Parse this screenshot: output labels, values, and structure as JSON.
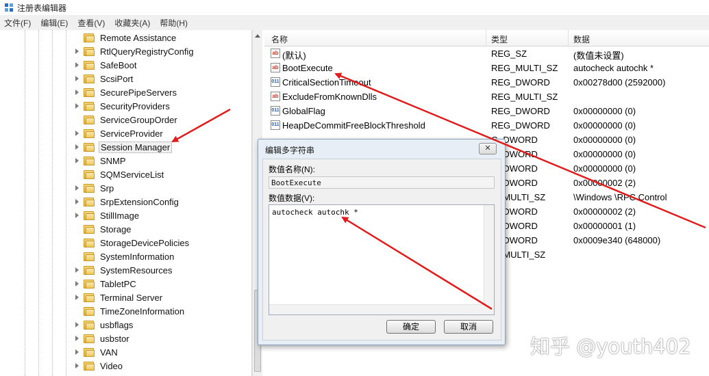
{
  "window": {
    "title": "注册表编辑器"
  },
  "menu": [
    "文件(F)",
    "编辑(E)",
    "查看(V)",
    "收藏夹(A)",
    "帮助(H)"
  ],
  "tree": {
    "items": [
      {
        "label": "Remote Assistance",
        "expander": false
      },
      {
        "label": "RtlQueryRegistryConfig",
        "expander": true
      },
      {
        "label": "SafeBoot",
        "expander": true
      },
      {
        "label": "ScsiPort",
        "expander": true
      },
      {
        "label": "SecurePipeServers",
        "expander": true
      },
      {
        "label": "SecurityProviders",
        "expander": true
      },
      {
        "label": "ServiceGroupOrder",
        "expander": false
      },
      {
        "label": "ServiceProvider",
        "expander": true
      },
      {
        "label": "Session Manager",
        "expander": true,
        "selected": true
      },
      {
        "label": "SNMP",
        "expander": true
      },
      {
        "label": "SQMServiceList",
        "expander": false
      },
      {
        "label": "Srp",
        "expander": true
      },
      {
        "label": "SrpExtensionConfig",
        "expander": true
      },
      {
        "label": "StillImage",
        "expander": true
      },
      {
        "label": "Storage",
        "expander": false
      },
      {
        "label": "StorageDevicePolicies",
        "expander": false
      },
      {
        "label": "SystemInformation",
        "expander": false
      },
      {
        "label": "SystemResources",
        "expander": true
      },
      {
        "label": "TabletPC",
        "expander": true
      },
      {
        "label": "Terminal Server",
        "expander": true
      },
      {
        "label": "TimeZoneInformation",
        "expander": false
      },
      {
        "label": "usbflags",
        "expander": true
      },
      {
        "label": "usbstor",
        "expander": true
      },
      {
        "label": "VAN",
        "expander": true
      },
      {
        "label": "Video",
        "expander": true
      }
    ]
  },
  "list": {
    "headers": {
      "name": "名称",
      "type": "类型",
      "data": "数据"
    },
    "rows": [
      {
        "icon": "string-value-icon",
        "name": "(默认)",
        "type": "REG_SZ",
        "data": "(数值未设置)"
      },
      {
        "icon": "string-value-icon",
        "name": "BootExecute",
        "type": "REG_MULTI_SZ",
        "data": "autocheck autochk *"
      },
      {
        "icon": "binary-value-icon",
        "name": "CriticalSectionTimeout",
        "type": "REG_DWORD",
        "data": "0x00278d00 (2592000)"
      },
      {
        "icon": "string-value-icon",
        "name": "ExcludeFromKnownDlls",
        "type": "REG_MULTI_SZ",
        "data": ""
      },
      {
        "icon": "binary-value-icon",
        "name": "GlobalFlag",
        "type": "REG_DWORD",
        "data": "0x00000000 (0)"
      },
      {
        "icon": "binary-value-icon",
        "name": "HeapDeCommitFreeBlockThreshold",
        "type": "REG_DWORD",
        "data": "0x00000000 (0)"
      },
      {
        "icon": "",
        "name": "",
        "type": "G_DWORD",
        "data": "0x00000000 (0)"
      },
      {
        "icon": "",
        "name": "",
        "type": "G_DWORD",
        "data": "0x00000000 (0)"
      },
      {
        "icon": "",
        "name": "",
        "type": "G_DWORD",
        "data": "0x00000000 (0)"
      },
      {
        "icon": "",
        "name": "",
        "type": "G_DWORD",
        "data": "0x00000002 (2)"
      },
      {
        "icon": "",
        "name": "",
        "type": "G_MULTI_SZ",
        "data": "\\Windows \\RPC Control"
      },
      {
        "icon": "",
        "name": "",
        "type": "G_DWORD",
        "data": "0x00000002 (2)"
      },
      {
        "icon": "",
        "name": "",
        "type": "G_DWORD",
        "data": "0x00000001 (1)"
      },
      {
        "icon": "",
        "name": "",
        "type": "G_DWORD",
        "data": "0x0009e340 (648000)"
      },
      {
        "icon": "",
        "name": "",
        "type": "G_MULTI_SZ",
        "data": ""
      }
    ]
  },
  "dialog": {
    "title": "编辑多字符串",
    "close": "✕",
    "name_label": "数值名称(N):",
    "name_value": "BootExecute",
    "data_label": "数值数据(V):",
    "data_value": "autocheck autochk *",
    "ok": "确定",
    "cancel": "取消"
  },
  "watermark": "知乎 @youth402",
  "colors": {
    "arrow": "#e11b1b",
    "selection": "#f0f0f0",
    "dialog_bg": "#e8eef6"
  }
}
